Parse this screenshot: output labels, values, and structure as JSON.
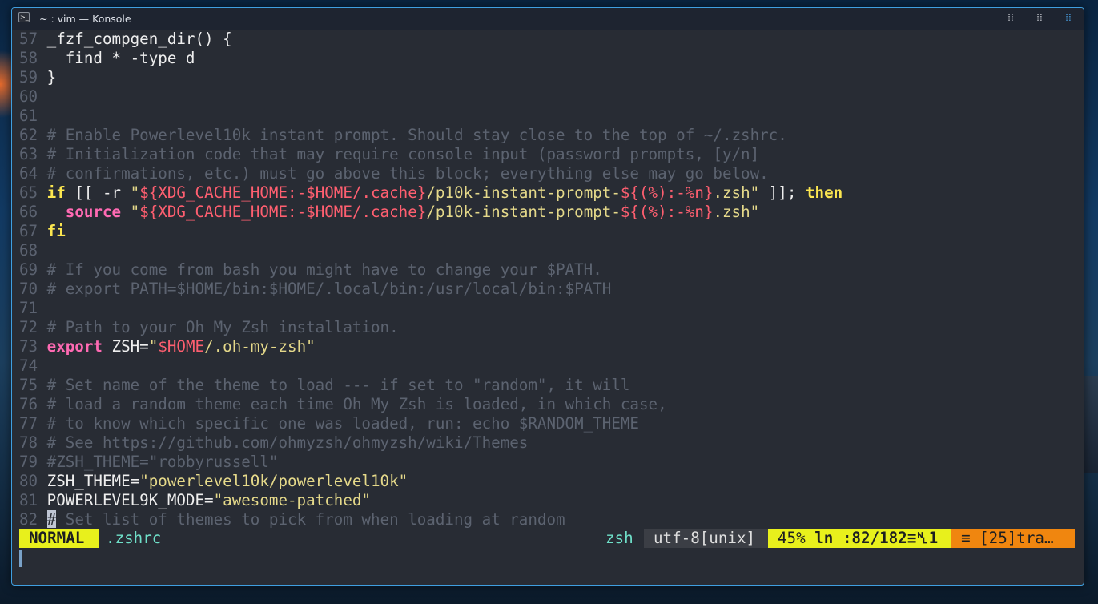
{
  "window": {
    "title": "~ : vim — Konsole",
    "app_icon": "terminal-icon",
    "buttons": [
      {
        "name": "window-menu-button",
        "icon": "grid-icon"
      },
      {
        "name": "window-split-button",
        "icon": "grid-icon"
      },
      {
        "name": "window-tile-button",
        "icon": "grid-icon"
      }
    ]
  },
  "editor": {
    "lines": [
      {
        "n": "57",
        "text": "_fzf_compgen_dir() {"
      },
      {
        "n": "58",
        "text": "  find * -type d"
      },
      {
        "n": "59",
        "text": "}"
      },
      {
        "n": "60",
        "text": ""
      },
      {
        "n": "61",
        "text": ""
      },
      {
        "n": "62",
        "text": "# Enable Powerlevel10k instant prompt. Should stay close to the top of ~/.zshrc."
      },
      {
        "n": "63",
        "text": "# Initialization code that may require console input (password prompts, [y/n]"
      },
      {
        "n": "64",
        "text": "# confirmations, etc.) must go above this block; everything else may go below."
      },
      {
        "n": "65",
        "text": "if [[ -r \"${XDG_CACHE_HOME:-$HOME/.cache}/p10k-instant-prompt-${(%):-%n}.zsh\" ]]; then"
      },
      {
        "n": "66",
        "text": "  source \"${XDG_CACHE_HOME:-$HOME/.cache}/p10k-instant-prompt-${(%):-%n}.zsh\""
      },
      {
        "n": "67",
        "text": "fi"
      },
      {
        "n": "68",
        "text": ""
      },
      {
        "n": "69",
        "text": "# If you come from bash you might have to change your $PATH."
      },
      {
        "n": "70",
        "text": "# export PATH=$HOME/bin:$HOME/.local/bin:/usr/local/bin:$PATH"
      },
      {
        "n": "71",
        "text": ""
      },
      {
        "n": "72",
        "text": "# Path to your Oh My Zsh installation."
      },
      {
        "n": "73",
        "text": "export ZSH=\"$HOME/.oh-my-zsh\""
      },
      {
        "n": "74",
        "text": ""
      },
      {
        "n": "75",
        "text": "# Set name of the theme to load --- if set to \"random\", it will"
      },
      {
        "n": "76",
        "text": "# load a random theme each time Oh My Zsh is loaded, in which case,"
      },
      {
        "n": "77",
        "text": "# to know which specific one was loaded, run: echo $RANDOM_THEME"
      },
      {
        "n": "78",
        "text": "# See https://github.com/ohmyzsh/ohmyzsh/wiki/Themes"
      },
      {
        "n": "79",
        "text": "#ZSH_THEME=\"robbyrussell\""
      },
      {
        "n": "80",
        "text": "ZSH_THEME=\"powerlevel10k/powerlevel10k\""
      },
      {
        "n": "81",
        "text": "POWERLEVEL9K_MODE=\"awesome-patched\""
      },
      {
        "n": "82",
        "text": "# Set list of themes to pick from when loading at random"
      }
    ]
  },
  "statusline": {
    "mode": "NORMAL",
    "filename": ".zshrc",
    "filetype": "zsh",
    "encoding": "utf-8[unix]",
    "percent": "45%",
    "position": "ln :82/182≡␤1",
    "warning": "≡ [25]tra…"
  },
  "colors": {
    "background": "#282c34",
    "mode_bg": "#e8f01c",
    "warning_bg": "#f0860f",
    "window_border": "#3f9fe0"
  }
}
